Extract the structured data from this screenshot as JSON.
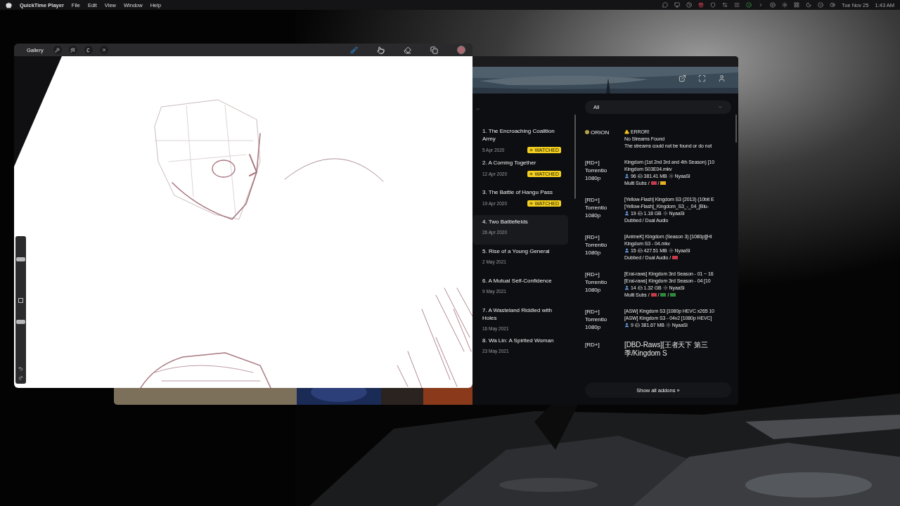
{
  "menu_bar": {
    "app_name": "QuickTime Player",
    "menus": [
      "File",
      "Edit",
      "View",
      "Window",
      "Help"
    ],
    "date": "Tue Nov 25",
    "time": "1:43 AM"
  },
  "drawing_app": {
    "gallery": "Gallery",
    "left_tools": [
      {
        "kind": "wrench",
        "selected": false
      },
      {
        "kind": "wand",
        "selected": false
      },
      {
        "kind": "selection",
        "selected": false
      },
      {
        "kind": "transform",
        "selected": false
      }
    ],
    "right_tools": [
      {
        "kind": "brush",
        "selected": true
      },
      {
        "kind": "smudge",
        "selected": false
      },
      {
        "kind": "eraser",
        "selected": false
      },
      {
        "kind": "layers",
        "selected": false
      }
    ],
    "brush_size": {
      "level": 0.6
    },
    "opacity": {
      "level": 0.85
    }
  },
  "streaming_app": {
    "episodes": [
      {
        "title": "1. The Encroaching Coalition Army",
        "date": "5 Apr 2020",
        "badge": "WATCHED",
        "selected": false
      },
      {
        "title": "2. A Coming Together",
        "date": "12 Apr 2020",
        "badge": "WATCHED",
        "selected": false
      },
      {
        "title": "3. The Battle of Hangu Pass",
        "date": "19 Apr 2020",
        "badge": "WATCHED",
        "selected": false
      },
      {
        "title": "4. Two Battlefields",
        "date": "26 Apr 2020",
        "selected": true
      },
      {
        "title": "5. Rise of a Young General",
        "date": "2 May 2021",
        "selected": false
      },
      {
        "title": "6. A Mutual Self-Confidence",
        "date": "9 May 2021",
        "selected": false
      },
      {
        "title": "7. A Wasteland Riddled with Holes",
        "date": "16 May 2021",
        "selected": false
      },
      {
        "title": "8. Wa Lin: A Spirited Woman",
        "date": "23 May 2021",
        "selected": false
      }
    ],
    "filter": {
      "value": "All"
    },
    "streams": [
      {
        "kind": "error",
        "addon": "ORION",
        "heading": "ERROR!",
        "lines": [
          "No Streams Found",
          "The streams could not be found or do not"
        ]
      },
      {
        "kind": "stream",
        "addon": "[RD+] Torrentio 1080p",
        "lines": [
          "Kingdom (1st 2nd 3rd and 4th Season) [10",
          "Kingdom S03E04.mkv"
        ],
        "seeders": "96",
        "size": "381.41 MB",
        "source": "NyaaSi",
        "tags": "Multi Subs",
        "separator": "/",
        "flags": [
          {
            "color": "#c8394a"
          },
          {
            "color": "#e8b020"
          }
        ]
      },
      {
        "kind": "stream",
        "addon": "[RD+] Torrentio 1080p",
        "lines": [
          "[Yellow-Flash] Kingdom S3 (2013) (10bit E",
          "[Yellow-Flash]_Kingdom_S3_-_04_[Blu-"
        ],
        "seeders": "19",
        "size": "1.18 GB",
        "source": "NyaaSi",
        "tags": "Dubbed / Dual Audio"
      },
      {
        "kind": "stream",
        "addon": "[RD+] Torrentio 1080p",
        "lines": [
          "[AnimeK] Kingdom (Season 3) [1080p][HI",
          "Kingdom S3 - 04.mkv"
        ],
        "seeders": "15",
        "size": "427.51 MB",
        "source": "NyaaSi",
        "tags": "Dubbed / Dual Audio",
        "separator": "/",
        "flags": [
          {
            "color": "#c8394a"
          }
        ]
      },
      {
        "kind": "stream",
        "addon": "[RD+] Torrentio 1080p",
        "lines": [
          "[Erai-raws] Kingdom 3rd Season - 01 ~ 16",
          "[Erai-raws] Kingdom 3rd Season - 04 [10"
        ],
        "seeders": "14",
        "size": "1.32 GB",
        "source": "NyaaSi",
        "tags": "Multi Subs",
        "separator": "/",
        "flags": [
          {
            "color": "#c8394a"
          },
          {
            "color": "#2e8b3a"
          },
          {
            "color": "#2e8b3a"
          }
        ]
      },
      {
        "kind": "stream",
        "addon": "[RD+] Torrentio 1080p",
        "lines": [
          "[ASW] Kingdom S3 [1080p HEVC x265 10",
          "[ASW] Kingdom S3 - 04v2 [1080p HEVC]"
        ],
        "seeders": "9",
        "size": "381.67 MB",
        "source": "NyaaSi"
      },
      {
        "kind": "stream",
        "addon": "[RD+]",
        "lines": [
          "[DBD-Raws][王者天下 第三季/Kingdom S"
        ]
      }
    ],
    "show_all": "Show all addons »"
  }
}
